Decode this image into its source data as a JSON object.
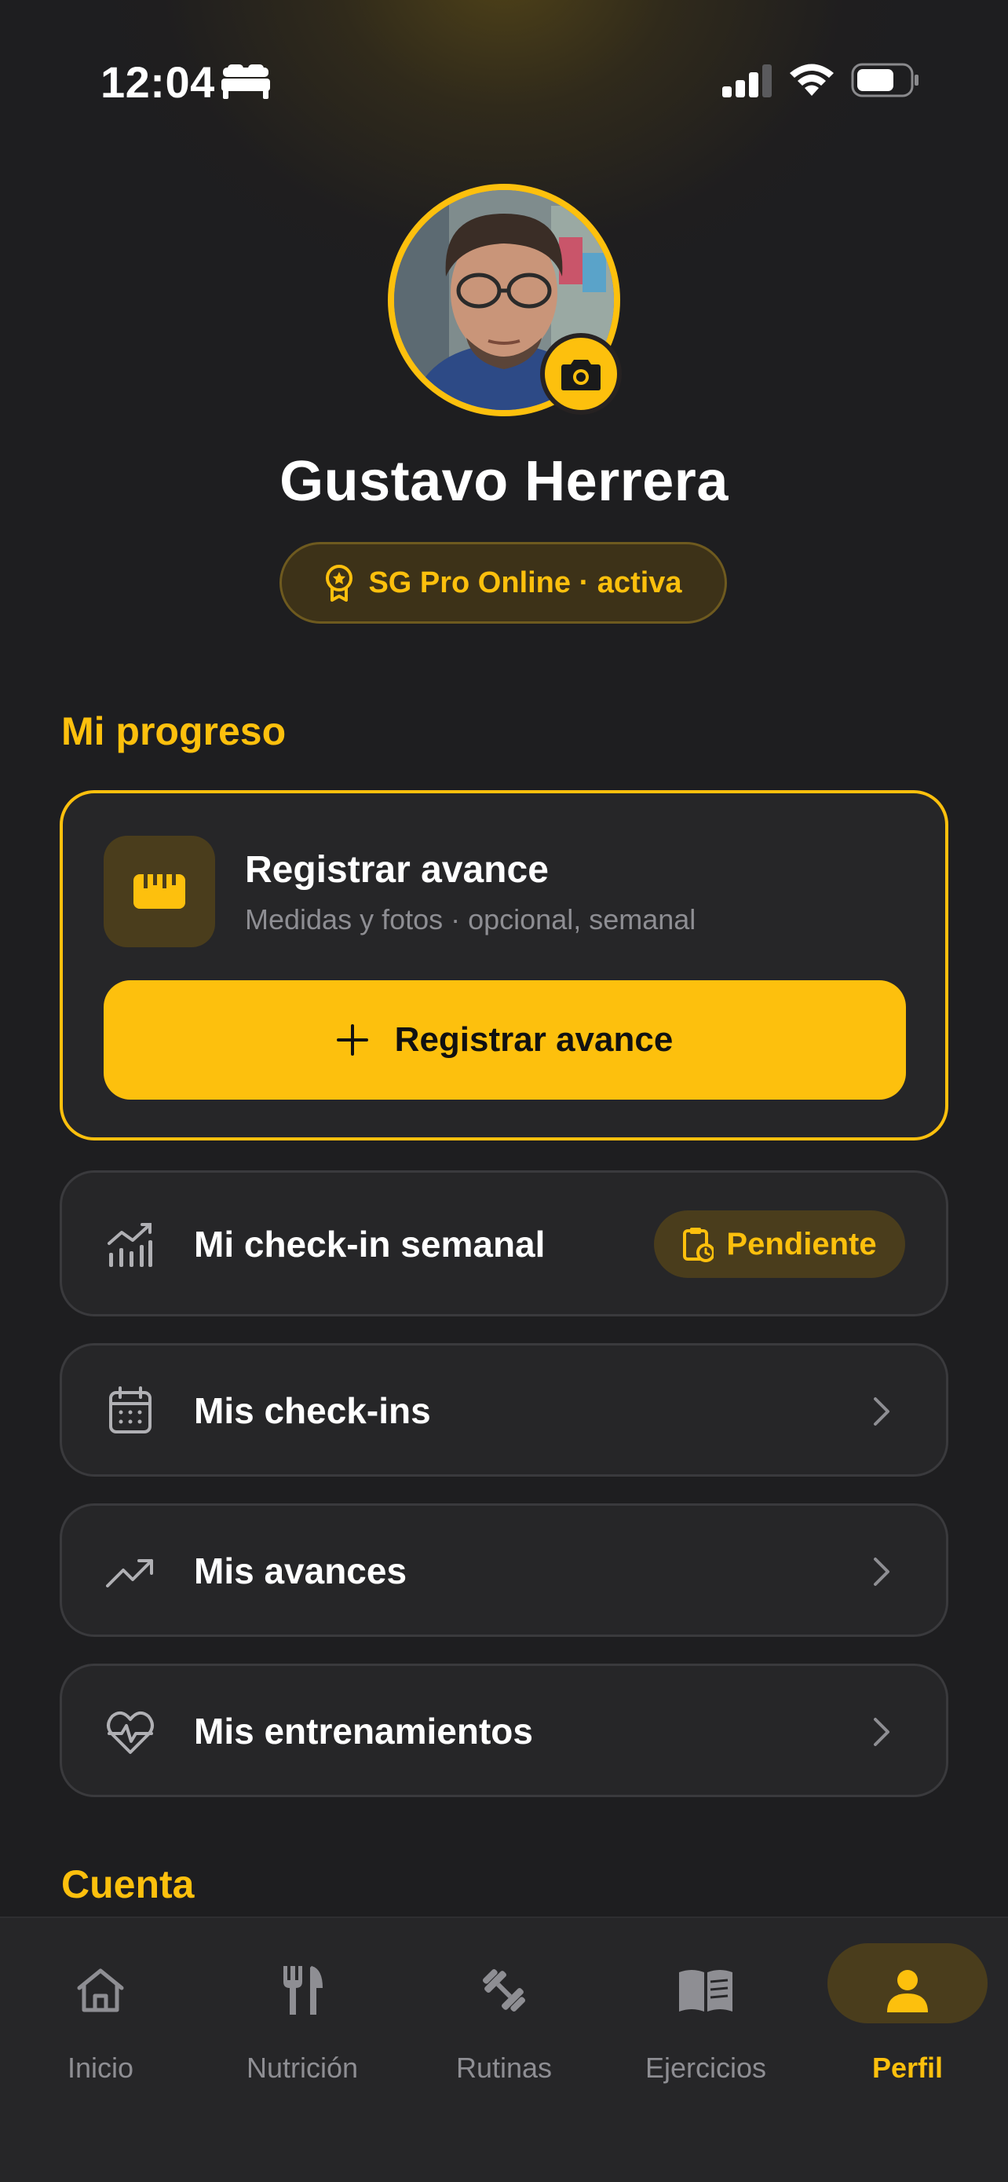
{
  "status_bar": {
    "time": "12:04",
    "icons": [
      "bed-icon",
      "signal-icon",
      "wifi-icon",
      "battery-icon"
    ]
  },
  "profile": {
    "name": "Gustavo Herrera",
    "membership": "SG Pro Online · activa",
    "icons": [
      "camera-icon",
      "award-icon"
    ]
  },
  "progress": {
    "title": "Mi progreso",
    "card": {
      "title": "Registrar avance",
      "subtitle": "Medidas y fotos · opcional, semanal",
      "button_label": "Registrar avance",
      "icons": [
        "ruler-icon",
        "plus-icon"
      ]
    },
    "rows": [
      {
        "label": "Mi check-in semanal",
        "icon": "chart-bars-icon",
        "badge": "Pendiente",
        "badge_icon": "clipboard-clock-icon"
      },
      {
        "label": "Mis check-ins",
        "icon": "calendar-icon"
      },
      {
        "label": "Mis avances",
        "icon": "trending-up-icon"
      },
      {
        "label": "Mis entrenamientos",
        "icon": "heart-pulse-icon"
      }
    ]
  },
  "account": {
    "title": "Cuenta"
  },
  "tabs": [
    {
      "label": "Inicio",
      "icon": "home-icon",
      "active": false
    },
    {
      "label": "Nutrición",
      "icon": "utensils-icon",
      "active": false
    },
    {
      "label": "Rutinas",
      "icon": "dumbbell-icon",
      "active": false
    },
    {
      "label": "Ejercicios",
      "icon": "book-icon",
      "active": false
    },
    {
      "label": "Perfil",
      "icon": "user-icon",
      "active": true
    }
  ],
  "colors": {
    "accent": "#fdc00d",
    "background": "#1e1e20",
    "card": "#262628",
    "muted_text": "#8e8e93",
    "badge_bg": "#4a3d1c"
  }
}
